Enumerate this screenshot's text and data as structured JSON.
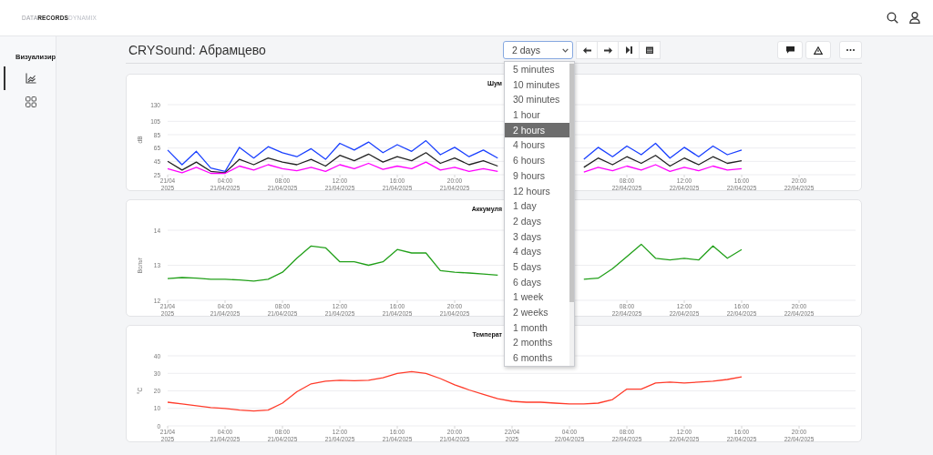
{
  "header": {
    "logo": [
      "DATA",
      "RECORDS",
      "DYNAMIX"
    ]
  },
  "sidebar": {
    "heading": "Визуализир",
    "items": [
      {
        "kind": "charts",
        "selected": true
      },
      {
        "kind": "dashboards",
        "selected": false
      }
    ]
  },
  "page": {
    "title": "CRYSound: Абрамцево"
  },
  "toolbar": {
    "period": "2 days",
    "period_options": [
      {
        "label": "5 minutes",
        "selected": false
      },
      {
        "label": "10 minutes",
        "selected": false
      },
      {
        "label": "30 minutes",
        "selected": false
      },
      {
        "label": "1 hour",
        "selected": false
      },
      {
        "label": "2 hours",
        "selected": true
      },
      {
        "label": "4 hours",
        "selected": false
      },
      {
        "label": "6 hours",
        "selected": false
      },
      {
        "label": "9 hours",
        "selected": false
      },
      {
        "label": "12 hours",
        "selected": false
      },
      {
        "label": "1 day",
        "selected": false
      },
      {
        "label": "2 days",
        "selected": false
      },
      {
        "label": "3 days",
        "selected": false
      },
      {
        "label": "4 days",
        "selected": false
      },
      {
        "label": "5 days",
        "selected": false
      },
      {
        "label": "6 days",
        "selected": false
      },
      {
        "label": "1 week",
        "selected": false
      },
      {
        "label": "2 weeks",
        "selected": false
      },
      {
        "label": "1 month",
        "selected": false
      },
      {
        "label": "2 months",
        "selected": false
      },
      {
        "label": "6 months",
        "selected": false
      }
    ]
  },
  "charts": [
    {
      "chart_data": {
        "type": "line",
        "grid": true,
        "title": "Шум",
        "ylabel": "dB",
        "ylim": [
          25,
          130
        ],
        "yticks": [
          25,
          45,
          65,
          85,
          105,
          130
        ],
        "categories": [
          "21/04 2025",
          null,
          null,
          null,
          "04:00 21/04/2025",
          null,
          null,
          null,
          "08:00 21/04/2025",
          null,
          null,
          null,
          "12:00 21/04/2025",
          null,
          null,
          null,
          "16:00 21/04/2025",
          null,
          null,
          null,
          "20:00 21/04/2025",
          null,
          null,
          null,
          null,
          null,
          null,
          null,
          null,
          null,
          null,
          null,
          "08:00 22/04/2025",
          null,
          null,
          null,
          "12:00 22/04/2025",
          null,
          null,
          null,
          "16:00 22/04/2025",
          null,
          null,
          null,
          "20:00 22/04/2025",
          null,
          null,
          null,
          null
        ],
        "series": [
          {
            "color": "#1a40ff",
            "values": [
              62,
              40,
              60,
              35,
              30,
              66,
              50,
              67,
              58,
              52,
              64,
              48,
              72,
              62,
              74,
              58,
              70,
              60,
              76,
              55,
              66,
              52,
              62,
              50,
              null,
              null,
              null,
              null,
              null,
              48,
              66,
              52,
              68,
              55,
              72,
              50,
              66,
              52,
              68,
              55,
              62,
              null,
              null,
              null,
              null,
              null,
              null,
              null,
              null
            ]
          },
          {
            "color": "#222222",
            "values": [
              45,
              32,
              44,
              30,
              28,
              48,
              40,
              50,
              44,
              40,
              48,
              38,
              54,
              46,
              56,
              44,
              52,
              46,
              58,
              42,
              50,
              40,
              46,
              38,
              null,
              null,
              null,
              null,
              null,
              36,
              50,
              40,
              52,
              42,
              54,
              38,
              50,
              40,
              52,
              42,
              46,
              null,
              null,
              null,
              null,
              null,
              null,
              null,
              null
            ]
          },
          {
            "color": "#ff00ff",
            "values": [
              34,
              28,
              36,
              27,
              27,
              38,
              32,
              40,
              34,
              31,
              36,
              30,
              40,
              34,
              42,
              33,
              38,
              34,
              44,
              32,
              36,
              30,
              34,
              30,
              null,
              null,
              null,
              null,
              null,
              29,
              36,
              31,
              38,
              32,
              40,
              30,
              36,
              31,
              38,
              32,
              34,
              null,
              null,
              null,
              null,
              null,
              null,
              null,
              null
            ]
          }
        ]
      }
    },
    {
      "chart_data": {
        "type": "line",
        "grid": true,
        "title": "Аккумуля",
        "ylabel": "Вольт",
        "ylim": [
          12,
          14
        ],
        "yticks": [
          12,
          13,
          14
        ],
        "categories": [
          "21/04 2025",
          null,
          null,
          null,
          "04:00 21/04/2025",
          null,
          null,
          null,
          "08:00 21/04/2025",
          null,
          null,
          null,
          "12:00 21/04/2025",
          null,
          null,
          null,
          "16:00 21/04/2025",
          null,
          null,
          null,
          "20:00 21/04/2025",
          null,
          null,
          null,
          null,
          null,
          null,
          null,
          null,
          null,
          null,
          null,
          "08:00 22/04/2025",
          null,
          null,
          null,
          "12:00 22/04/2025",
          null,
          null,
          null,
          "16:00 22/04/2025",
          null,
          null,
          null,
          "20:00 22/04/2025",
          null,
          null,
          null,
          null
        ],
        "series": [
          {
            "color": "#22a01a",
            "values": [
              12.62,
              12.65,
              12.63,
              12.6,
              12.6,
              12.58,
              12.55,
              12.6,
              12.8,
              13.2,
              13.55,
              13.5,
              13.1,
              13.1,
              13.0,
              13.1,
              13.45,
              13.35,
              13.35,
              12.85,
              12.8,
              12.78,
              12.75,
              12.72,
              null,
              null,
              null,
              null,
              null,
              12.6,
              12.63,
              12.9,
              13.25,
              13.6,
              13.2,
              13.15,
              13.2,
              13.15,
              13.55,
              13.2,
              13.45,
              null,
              null,
              null,
              null,
              null,
              null,
              null,
              null
            ]
          }
        ]
      }
    },
    {
      "chart_data": {
        "type": "line",
        "grid": true,
        "title": "Температ",
        "ylabel": "°C",
        "ylim": [
          0,
          40
        ],
        "yticks": [
          0,
          10,
          20,
          30,
          40
        ],
        "categories": [
          "21/04 2025",
          null,
          null,
          null,
          "04:00 21/04/2025",
          null,
          null,
          null,
          "08:00 21/04/2025",
          null,
          null,
          null,
          "12:00 21/04/2025",
          null,
          null,
          null,
          "16:00 21/04/2025",
          null,
          null,
          null,
          "20:00 21/04/2025",
          null,
          null,
          null,
          "22/04 2025",
          null,
          null,
          null,
          "04:00 22/04/2025",
          null,
          null,
          null,
          "08:00 22/04/2025",
          null,
          null,
          null,
          "12:00 22/04/2025",
          null,
          null,
          null,
          "16:00 22/04/2025",
          null,
          null,
          null,
          "20:00 22/04/2025",
          null,
          null,
          null,
          null
        ],
        "series": [
          {
            "color": "#ff3b2a",
            "values": [
              13.5,
              12.5,
              11.5,
              10.5,
              10,
              9,
              8.5,
              9,
              13,
              19.5,
              24,
              25.5,
              26,
              25.8,
              26,
              27.5,
              30,
              31,
              30,
              27,
              23.5,
              20.5,
              18,
              15.5,
              14,
              13.5,
              13.5,
              13,
              12.5,
              12.5,
              13,
              15,
              21,
              21,
              24.5,
              25,
              24.5,
              25,
              25.5,
              26.5,
              28,
              null,
              null,
              null,
              null,
              null,
              null,
              null,
              null
            ]
          }
        ]
      }
    }
  ]
}
